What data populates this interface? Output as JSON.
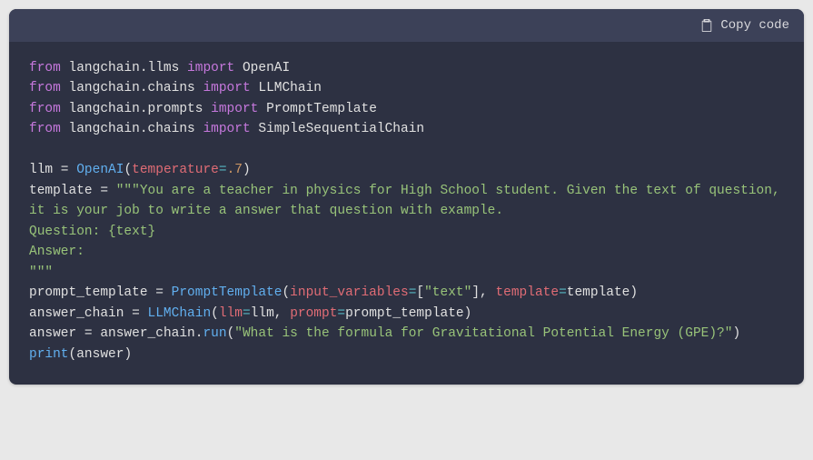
{
  "header": {
    "copy_label": "Copy code"
  },
  "code": {
    "l1_kw1": "from",
    "l1_mod": "langchain.llms",
    "l1_kw2": "import",
    "l1_cls": "OpenAI",
    "l2_kw1": "from",
    "l2_mod": "langchain.chains",
    "l2_kw2": "import",
    "l2_cls": "LLMChain",
    "l3_kw1": "from",
    "l3_mod": "langchain.prompts",
    "l3_kw2": "import",
    "l3_cls": "PromptTemplate",
    "l4_kw1": "from",
    "l4_mod": "langchain.chains",
    "l4_kw2": "import",
    "l4_cls": "SimpleSequentialChain",
    "l6_var": "llm",
    "l6_eq": " = ",
    "l6_fn": "OpenAI",
    "l6_lp": "(",
    "l6_param": "temperature",
    "l6_assign": "=",
    "l6_num": ".7",
    "l6_rp": ")",
    "l7_var": "template",
    "l7_eq": " = ",
    "l7_str": "\"\"\"You are a teacher in physics for High School student. Given the text of question, it is your job to write a answer that question with example.\nQuestion: {text}\nAnswer:\n\"\"\"",
    "l11_var": "prompt_template",
    "l11_eq": " = ",
    "l11_fn": "PromptTemplate",
    "l11_lp": "(",
    "l11_p1": "input_variables",
    "l11_as1": "=",
    "l11_lb": "[",
    "l11_s1": "\"text\"",
    "l11_rb": "]",
    "l11_comma": ", ",
    "l11_p2": "template",
    "l11_as2": "=",
    "l11_v2": "template",
    "l11_rp": ")",
    "l12_var": "answer_chain",
    "l12_eq": " = ",
    "l12_fn": "LLMChain",
    "l12_lp": "(",
    "l12_p1": "llm",
    "l12_as1": "=",
    "l12_v1": "llm",
    "l12_comma": ", ",
    "l12_p2": "prompt",
    "l12_as2": "=",
    "l12_v2": "prompt_template",
    "l12_rp": ")",
    "l13_var": "answer",
    "l13_eq": " = ",
    "l13_obj": "answer_chain",
    "l13_dot": ".",
    "l13_fn": "run",
    "l13_lp": "(",
    "l13_str": "\"What is the formula for Gravitational Potential Energy (GPE)?\"",
    "l13_rp": ")",
    "l14_fn": "print",
    "l14_lp": "(",
    "l14_arg": "answer",
    "l14_rp": ")"
  }
}
